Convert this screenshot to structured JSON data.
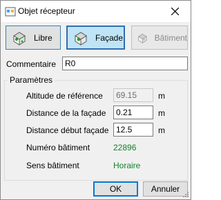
{
  "window": {
    "title": "Objet récepteur"
  },
  "modes": [
    {
      "label": "Libre",
      "icon": "house-libre-icon",
      "state": "normal"
    },
    {
      "label": "Façade",
      "icon": "house-facade-icon",
      "state": "selected"
    },
    {
      "label": "Bâtiment",
      "icon": "building-icon",
      "state": "disabled"
    }
  ],
  "comment": {
    "label": "Commentaire",
    "value": "R0"
  },
  "params": {
    "title": "Paramètres",
    "altitude": {
      "label": "Altitude de référence",
      "value": "69.15",
      "unit": "m"
    },
    "distance_facade": {
      "label": "Distance de la façade",
      "value": "0.21",
      "unit": "m"
    },
    "distance_debut": {
      "label": "Distance début façade",
      "value": "12.5",
      "unit": "m"
    },
    "numero_batiment": {
      "label": "Numéro bâtiment",
      "value": "22896"
    },
    "sens_batiment": {
      "label": "Sens bâtiment",
      "value": "Horaire"
    }
  },
  "actions": {
    "ok": "OK",
    "cancel": "Annuler"
  },
  "colors": {
    "accent": "#0078d7",
    "selected_bg": "#bfe4f5",
    "value_green": "#17802a"
  }
}
